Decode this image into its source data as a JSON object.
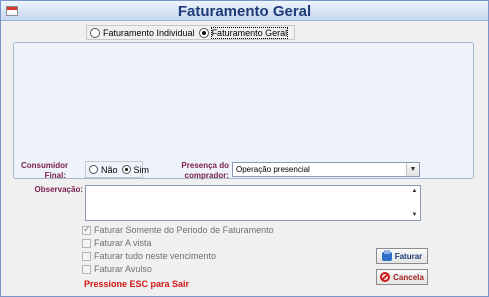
{
  "window": {
    "title": "Faturamento Geral"
  },
  "mode_options": [
    {
      "label": "Faturamento Individual",
      "checked": false
    },
    {
      "label": "Faturamento Geral",
      "checked": true
    }
  ],
  "consumidor_final": {
    "label": "Consumidor Final:",
    "options": [
      {
        "label": "Não",
        "checked": false
      },
      {
        "label": "Sim",
        "checked": true
      }
    ]
  },
  "presenca": {
    "label": "Presença do comprador:",
    "value": "Operação presencial"
  },
  "observacao": {
    "label": "Observação:",
    "value": ""
  },
  "checkboxes": [
    {
      "label": "Faturar Somente do Periodo de Faturamento",
      "checked": true
    },
    {
      "label": "Faturar A vista",
      "checked": false
    },
    {
      "label": "Faturar tudo neste vencimento",
      "checked": false
    },
    {
      "label": "Faturar Avulso",
      "checked": false
    }
  ],
  "hint": "Pressione ESC para Sair",
  "buttons": {
    "faturar": "Faturar",
    "cancela": "Cancela"
  },
  "colors": {
    "title": "#1f3b78",
    "label": "#7a1f4d",
    "hint": "#d21414"
  }
}
